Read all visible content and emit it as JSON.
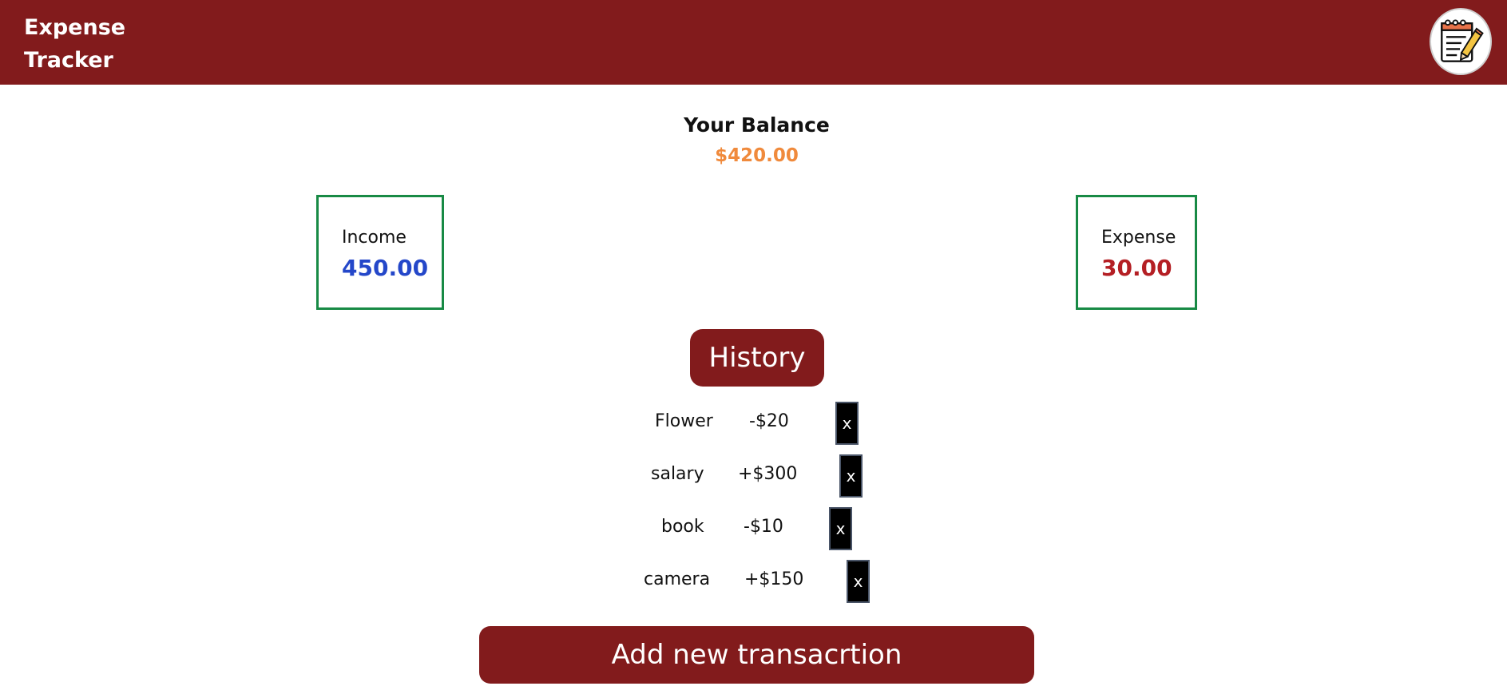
{
  "header": {
    "title_line1": "Expense",
    "title_line2": "Tracker",
    "logo_icon": "notepad-pencil-icon"
  },
  "balance": {
    "label": "Your Balance",
    "value": "$420.00"
  },
  "income": {
    "label": "Income",
    "value": "450.00"
  },
  "expense": {
    "label": "Expense",
    "value": "30.00"
  },
  "history": {
    "label": "History",
    "transactions": [
      {
        "name": "Flower",
        "amount": "-$20",
        "delete_label": "x"
      },
      {
        "name": "salary",
        "amount": "+$300",
        "delete_label": "x"
      },
      {
        "name": "book",
        "amount": "-$10",
        "delete_label": "x"
      },
      {
        "name": "camera",
        "amount": "+$150",
        "delete_label": "x"
      }
    ]
  },
  "actions": {
    "add_label": "Add new transacrtion"
  },
  "colors": {
    "brand": "#821b1c",
    "balance": "#f08a3c",
    "income": "#2447c9",
    "expense": "#b41f24",
    "card_border": "#188a45"
  }
}
